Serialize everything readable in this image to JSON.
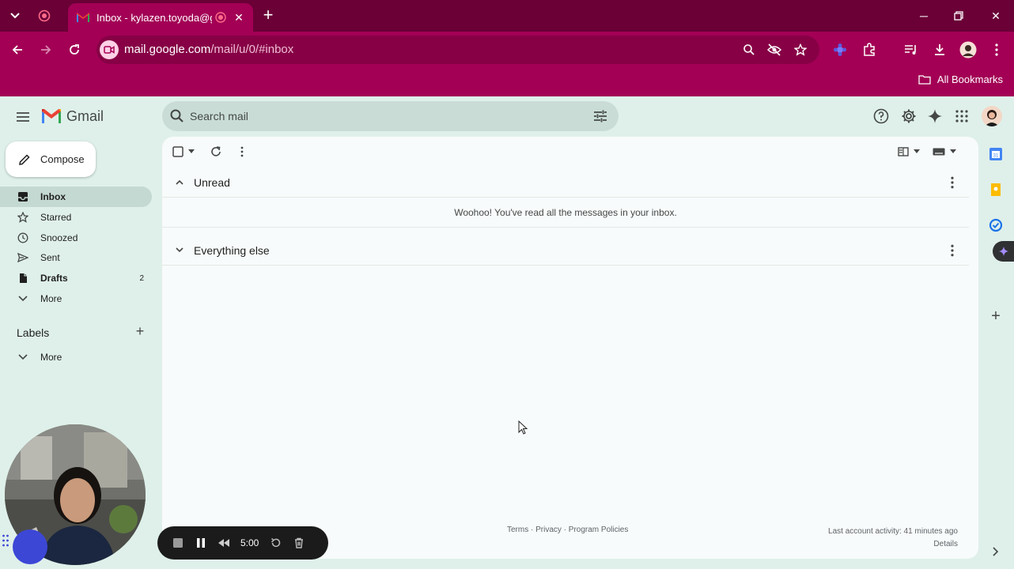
{
  "browser": {
    "tab_title": "Inbox - kylazen.toyoda@gm",
    "url_host": "mail.google.com",
    "url_path": "/mail/u/0/#inbox",
    "bookmarks_label": "All Bookmarks",
    "accent_color": "#a30055"
  },
  "header": {
    "app_name": "Gmail",
    "search_placeholder": "Search mail"
  },
  "sidebar": {
    "compose_label": "Compose",
    "items": [
      {
        "label": "Inbox",
        "icon": "inbox-icon",
        "active": true
      },
      {
        "label": "Starred",
        "icon": "star-icon"
      },
      {
        "label": "Snoozed",
        "icon": "clock-icon"
      },
      {
        "label": "Sent",
        "icon": "send-icon"
      },
      {
        "label": "Drafts",
        "icon": "draft-icon",
        "count": "2"
      },
      {
        "label": "More",
        "icon": "chevron-down-icon"
      }
    ],
    "labels_heading": "Labels",
    "labels_more": "More"
  },
  "main": {
    "sections": [
      {
        "label": "Unread",
        "expanded": true
      },
      {
        "label": "Everything else",
        "expanded": false
      }
    ],
    "empty_message": "Woohoo! You've read all the messages in your inbox.",
    "footer_links": "Terms · Privacy · Program Policies",
    "last_activity": "Last account activity: 41 minutes ago",
    "details_label": "Details"
  },
  "recorder": {
    "time": "5:00"
  }
}
